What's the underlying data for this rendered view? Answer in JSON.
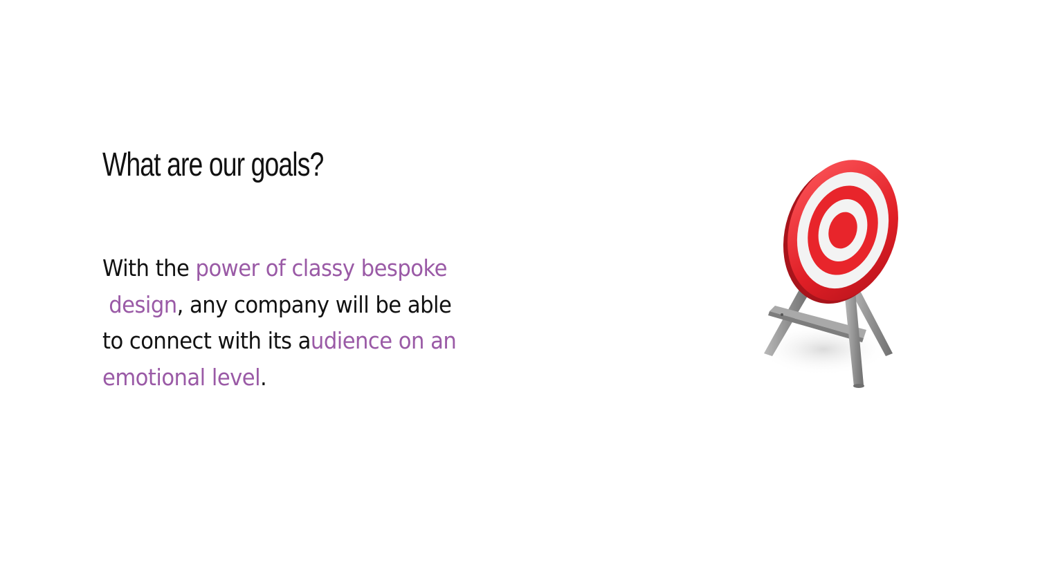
{
  "slide": {
    "title": "What are our goals?",
    "body_lines": [
      {
        "plain_before": "With the ",
        "accent": "power of classy bespoke",
        "plain_after": ""
      },
      {
        "plain_before": "",
        "accent": " design",
        "plain_after": ", any company will be able"
      },
      {
        "plain_before": "to connect with its a",
        "accent": "udience on an",
        "plain_after": ""
      },
      {
        "plain_before": "",
        "accent": "emotional level",
        "plain_after": "."
      }
    ],
    "illustration": {
      "icon": "archery-target-icon"
    }
  },
  "colors": {
    "text": "#111111",
    "accent": "#9a5aa6",
    "target_red": "#e8252b",
    "target_white": "#f4f4f4",
    "stand_gray": "#9c9c9c",
    "background": "#ffffff"
  }
}
